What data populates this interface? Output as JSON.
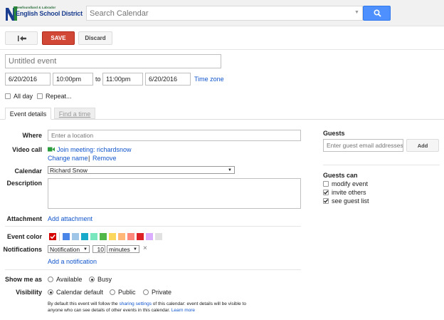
{
  "header": {
    "logo_subtitle": "Newfoundland & Labrador",
    "logo_title": "English School District",
    "search_placeholder": "Search Calendar"
  },
  "toolbar": {
    "save_label": "SAVE",
    "discard_label": "Discard"
  },
  "event": {
    "title_placeholder": "Untitled event",
    "start_date": "6/20/2016",
    "start_time": "10:00pm",
    "to_label": "to",
    "end_time": "11:00pm",
    "end_date": "6/20/2016",
    "timezone_link": "Time zone",
    "allday_label": "All day",
    "repeat_label": "Repeat..."
  },
  "tabs": [
    {
      "label": "Event details"
    },
    {
      "label": "Find a time"
    }
  ],
  "details": {
    "where_label": "Where",
    "where_placeholder": "Enter a location",
    "videocall_label": "Video call",
    "join_meeting": "Join meeting: richardsnow",
    "change_name": "Change name",
    "separator": "|",
    "remove": "Remove",
    "calendar_label": "Calendar",
    "calendar_value": "Richard Snow",
    "description_label": "Description",
    "attachment_label": "Attachment",
    "add_attachment": "Add attachment",
    "event_color_label": "Event color",
    "notifications_label": "Notifications",
    "notification_type": "Notification",
    "notification_amount": "10",
    "notification_unit": "minutes",
    "remove_notification": "×",
    "add_notification": "Add a notification",
    "show_me_as_label": "Show me as",
    "available_label": "Available",
    "busy_label": "Busy",
    "visibility_label": "Visibility",
    "calendar_default_label": "Calendar default",
    "public_label": "Public",
    "private_label": "Private",
    "note_line1_a": "By default this event will follow the ",
    "note_link": "sharing settings",
    "note_line1_b": " of this calendar: event details will be visible to",
    "note_line2": "anyone who can see details of other events in this calendar.",
    "learn_more": "Learn more"
  },
  "colors": {
    "swatches": [
      "#d50000",
      "#4986e7",
      "#9fc6e7",
      "#16a9c9",
      "#7ae7bf",
      "#51b749",
      "#fbd75b",
      "#ffb878",
      "#ff887c",
      "#dc2127",
      "#dbadff",
      "#e1e1e1"
    ],
    "accent_blue": "#4d90fe",
    "save_red": "#d14836"
  },
  "guests": {
    "header": "Guests",
    "input_placeholder": "Enter guest email addresses",
    "add_button": "Add",
    "can_header": "Guests can",
    "permissions": [
      {
        "label": "modify event",
        "checked": false
      },
      {
        "label": "invite others",
        "checked": true
      },
      {
        "label": "see guest list",
        "checked": true
      }
    ]
  },
  "icons": {
    "search": "search-icon",
    "back": "back-arrow-icon",
    "video": "video-icon",
    "dropdown": "chevron-down-icon",
    "check": "checkmark-icon"
  }
}
